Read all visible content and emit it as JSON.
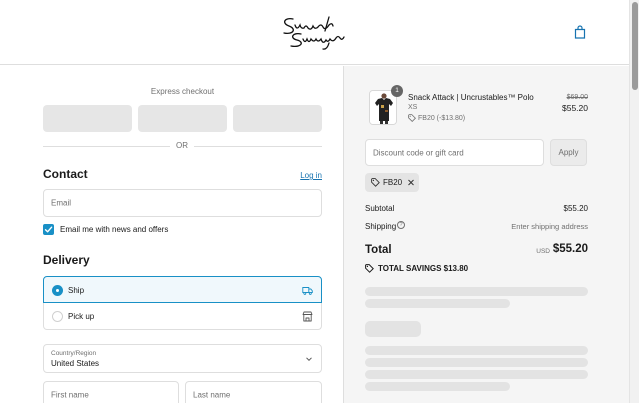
{
  "header": {
    "brand_name": "Sunday Swagger",
    "cart_icon": "shopping-bag-icon"
  },
  "express": {
    "title": "Express checkout",
    "or_label": "OR"
  },
  "contact": {
    "title": "Contact",
    "login_label": "Log in",
    "email_placeholder": "Email",
    "news_label": "Email me with news and offers",
    "news_checked": true
  },
  "delivery": {
    "title": "Delivery",
    "options": [
      {
        "label": "Ship",
        "selected": true,
        "icon": "truck-icon"
      },
      {
        "label": "Pick up",
        "selected": false,
        "icon": "store-icon"
      }
    ],
    "country_label": "Country/Region",
    "country_value": "United States",
    "first_name_placeholder": "First name",
    "last_name_placeholder": "Last name"
  },
  "summary": {
    "item": {
      "quantity": "1",
      "name": "Snack Attack | Uncrustables™ Polo",
      "variant": "XS",
      "discount": "FB20 (-$13.80)",
      "original_price": "$69.00",
      "price": "$55.20"
    },
    "discount_placeholder": "Discount code or gift card",
    "apply_label": "Apply",
    "applied_code": "FB20",
    "subtotal_label": "Subtotal",
    "subtotal_value": "$55.20",
    "shipping_label": "Shipping",
    "shipping_value": "Enter shipping address",
    "total_label": "Total",
    "currency": "USD",
    "total_value": "$55.20",
    "savings": "TOTAL SAVINGS $13.80"
  },
  "colors": {
    "accent": "#1990c6",
    "link": "#1773b0",
    "panel": "#f5f5f5"
  }
}
